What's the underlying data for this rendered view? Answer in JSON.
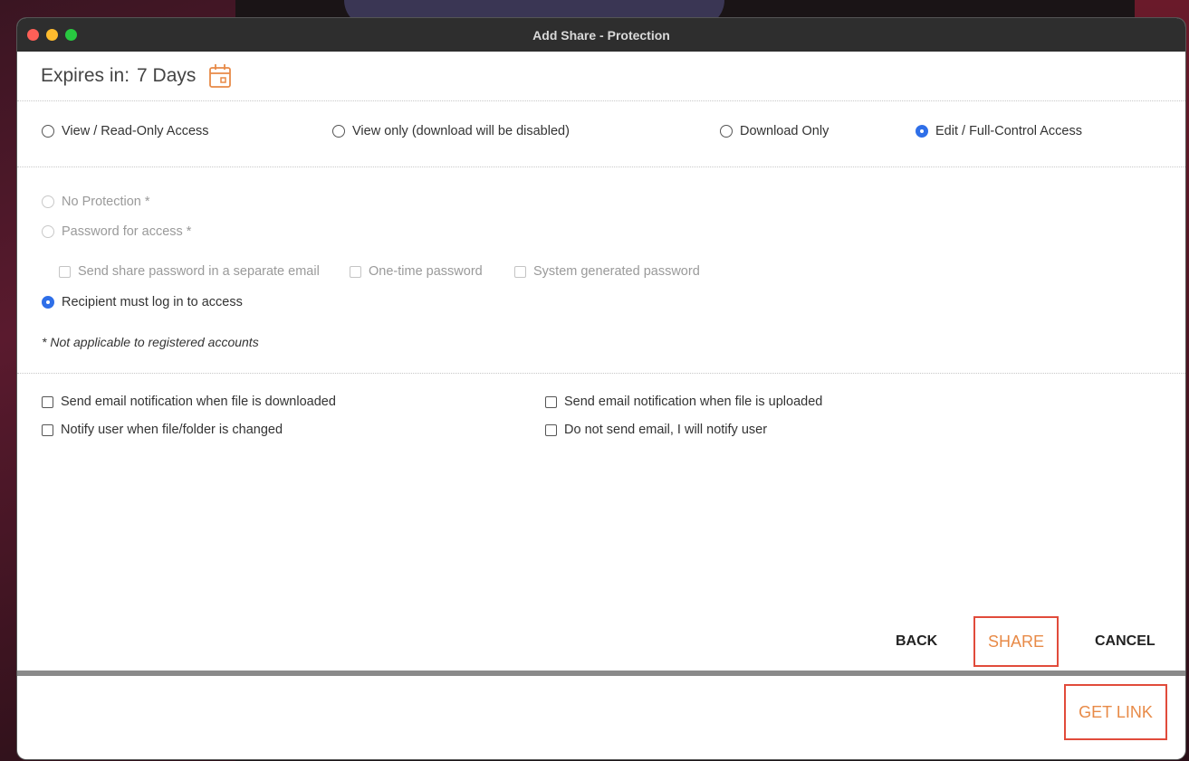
{
  "window": {
    "title": "Add Share - Protection"
  },
  "expires": {
    "label": "Expires in:",
    "value": "7 Days",
    "icon": "calendar-icon",
    "icon_color": "#e88a47"
  },
  "access": {
    "options": [
      {
        "label": "View / Read-Only Access",
        "selected": false
      },
      {
        "label": "View only (download will be disabled)",
        "selected": false
      },
      {
        "label": "Download Only",
        "selected": false
      },
      {
        "label": "Edit / Full-Control Access",
        "selected": true
      }
    ]
  },
  "protection": {
    "no_protection": "No Protection *",
    "password": "Password for access *",
    "password_options": [
      "Send share password in a separate email",
      "One-time password",
      "System generated password"
    ],
    "login_required": "Recipient must log in to access",
    "note": "* Not applicable to registered accounts"
  },
  "notifications": {
    "items": [
      "Send email notification when file is downloaded",
      "Send email notification when file is uploaded",
      "Notify user when file/folder is changed",
      "Do not send email, I will notify user"
    ]
  },
  "actions": {
    "back": "BACK",
    "share": "SHARE",
    "cancel": "CANCEL",
    "get_link": "GET LINK"
  },
  "colors": {
    "accent": "#e88a47",
    "highlight_border": "#e14b3b",
    "radio_selected": "#2f6fe8"
  }
}
